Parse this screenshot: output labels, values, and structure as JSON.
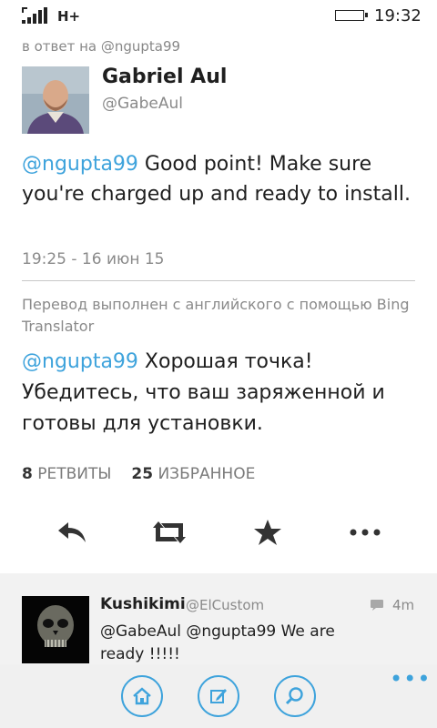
{
  "status": {
    "network": "H+",
    "time": "19:32"
  },
  "tweet": {
    "reply_to": "в ответ на @ngupta99",
    "author_name": "Gabriel Aul",
    "author_handle": "@GabeAul",
    "mention": "@ngupta99",
    "text": " Good point! Make sure you're charged up and ready to install.",
    "time": "19:25 - 16 июн 15",
    "translation_note": "Перевод выполнен с английского с помощью Bing Translator",
    "translated_mention": "@ngupta99",
    "translated_text": " Хорошая точка! Убедитесь, что ваш заряженной и готовы для установки.",
    "retweets_count": "8",
    "retweets_label": "РЕТВИТЫ",
    "favorites_count": "25",
    "favorites_label": "ИЗБРАННОЕ"
  },
  "actions": [
    "reply-icon",
    "retweet-icon",
    "favorite-icon",
    "more-icon"
  ],
  "reply": {
    "name": "Kushikimi",
    "handle": "@ElCustom",
    "time": "4m",
    "text": "@GabeAul @ngupta99 We are ready !!!!!"
  },
  "appbar": [
    "home-icon",
    "compose-icon",
    "search-icon"
  ],
  "colors": {
    "accent": "#3ea3dc",
    "text": "#1f1f1f",
    "muted": "#8a8a8a",
    "appbar": "#f0f0f0"
  }
}
